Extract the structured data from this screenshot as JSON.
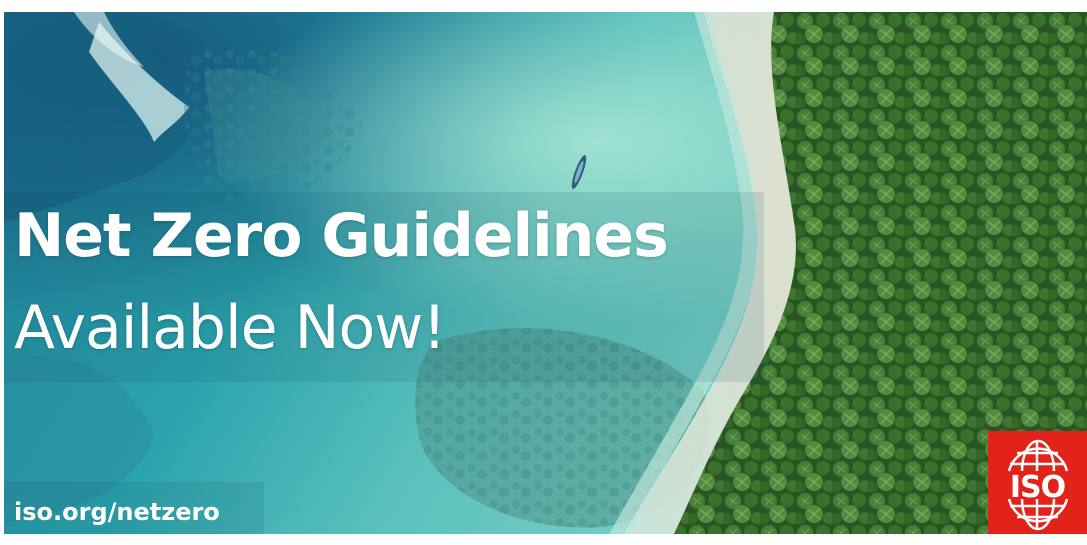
{
  "headline": "Net Zero Guidelines",
  "subline": "Available Now!",
  "url": "iso.org/netzero",
  "logo": {
    "text": "ISO",
    "icon": "globe-icon",
    "color": "#e2231a"
  },
  "colors": {
    "sea": "#2a9aa6",
    "text": "#ffffff",
    "forest": "#2f5a2a"
  }
}
